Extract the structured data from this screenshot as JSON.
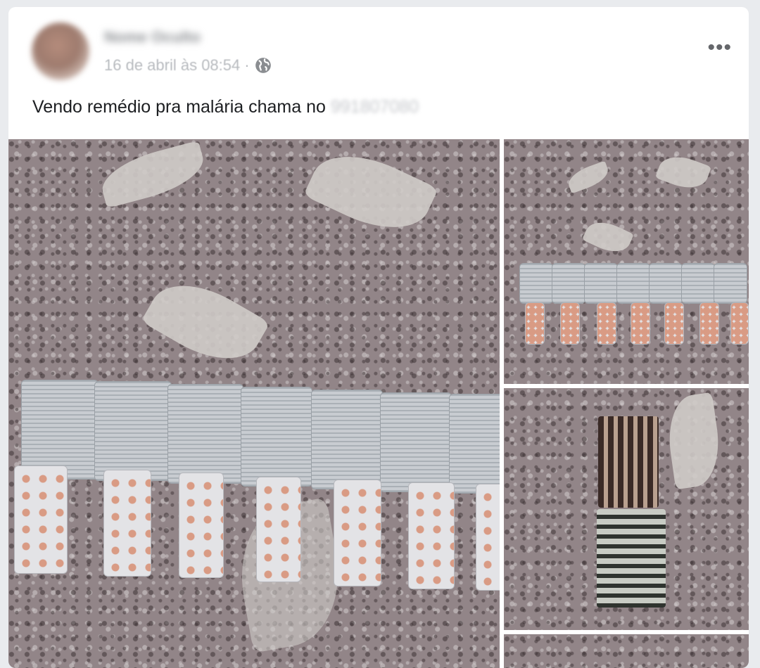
{
  "post": {
    "author": "Nome Oculto",
    "date": "16 de abril às 08:54",
    "separator": "·",
    "privacy_icon": "globe-icon",
    "options_icon": "more-options-icon",
    "options_label": "•••",
    "text_main": "Vendo remédio pra malária chama no ",
    "text_number_blurred": "991807080"
  },
  "photos": [
    {
      "alt": "Cartelas de comprimidos sobre tecido",
      "position": "main"
    },
    {
      "alt": "Cartelas de comprimidos enfileiradas",
      "position": "top-right"
    },
    {
      "alt": "Pilhas de cartelas de comprimidos",
      "position": "middle-right"
    },
    {
      "alt": "Mais fotos",
      "position": "bottom-right"
    }
  ]
}
